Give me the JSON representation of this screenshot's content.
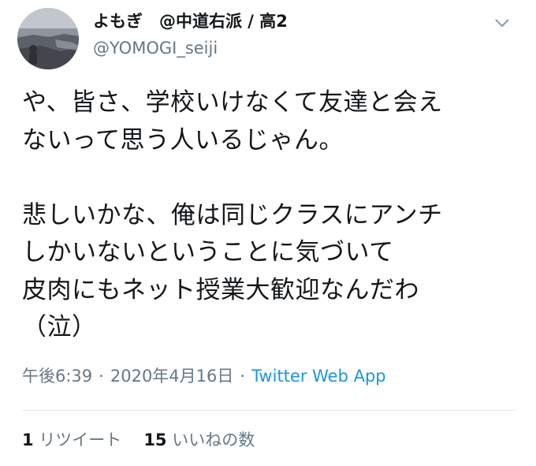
{
  "user": {
    "display_name": "よもぎ　@中道右派 / 高2",
    "screen_name": "@YOMOGI_seiji"
  },
  "tweet": {
    "text": "や、皆さ、学校いけなくて友達と会え\nないって思う人いるじゃん。\n\n悲しいかな、俺は同じクラスにアンチ\nしかいないということに気づいて\n皮肉にもネット授業大歓迎なんだわ\n（泣）",
    "time": "午後6:39",
    "separator": "·",
    "date": "2020年4月16日",
    "source": "Twitter Web App"
  },
  "stats": {
    "retweets": "1",
    "retweets_label": "リツイート",
    "likes": "15",
    "likes_label": "いいねの数"
  },
  "icons": {
    "more": "chevron-down-icon",
    "avatar": "avatar"
  },
  "colors": {
    "primary_text": "#14171a",
    "secondary_text": "#657786",
    "link": "#1b95e0",
    "divider": "#e1e8ed"
  }
}
